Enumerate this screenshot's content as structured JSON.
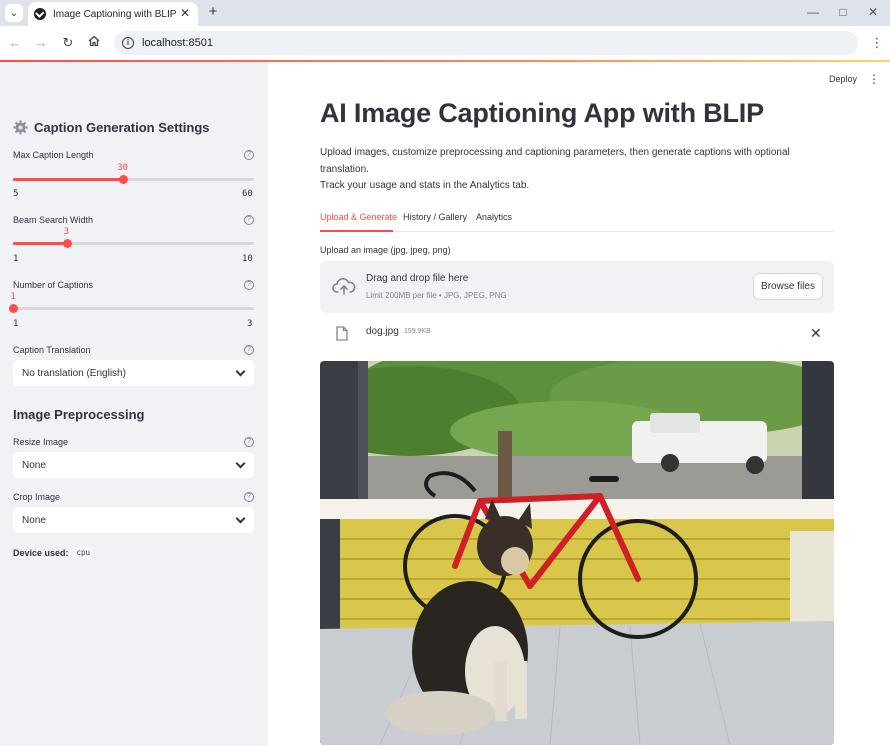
{
  "browser": {
    "tab_title": "Image Captioning with BLIP + A",
    "url": "localhost:8501",
    "icons": [
      "tab-search-icon",
      "favicon-icon",
      "close-icon",
      "plus-icon",
      "minimize-icon",
      "maximize-icon",
      "close-window-icon",
      "back-arrow-icon",
      "forward-arrow-icon",
      "reload-icon",
      "home-icon",
      "site-info-icon",
      "menu-kebab-icon"
    ]
  },
  "sidebar": {
    "title": "Caption Generation Settings",
    "sliders": [
      {
        "label": "Max Caption Length",
        "value": "30",
        "min": "5",
        "max": "60",
        "fraction": 0.455
      },
      {
        "label": "Beam Search Width",
        "value": "3",
        "min": "1",
        "max": "10",
        "fraction": 0.222
      },
      {
        "label": "Number of Captions",
        "value": "1",
        "min": "1",
        "max": "3",
        "fraction": 0.0
      }
    ],
    "translation": {
      "label": "Caption Translation",
      "value": "No translation (English)"
    },
    "preprocessing_heading": "Image Preprocessing",
    "resize": {
      "label": "Resize Image",
      "value": "None"
    },
    "crop": {
      "label": "Crop Image",
      "value": "None"
    },
    "device_label": "Device used:",
    "device_value": "cpu"
  },
  "header": {
    "deploy_label": "Deploy",
    "menu_glyph": "⋮"
  },
  "main": {
    "title": "AI Image Captioning App with BLIP",
    "description_line1": "Upload images, customize preprocessing and captioning parameters, then generate captions with optional translation.",
    "description_line2": "Track your usage and stats in the Analytics tab.",
    "tabs": [
      "Upload & Generate",
      "History / Gallery",
      "Analytics"
    ],
    "active_tab": 0,
    "uploader": {
      "label": "Upload an image (jpg, jpeg, png)",
      "drop_text": "Drag and drop file here",
      "limit_text": "Limit 200MB per file • JPG, JPEG, PNG",
      "browse_label": "Browse files"
    },
    "file": {
      "name": "dog.jpg",
      "size": "159.9KB"
    }
  },
  "colors": {
    "accent": "#ff4b4b",
    "sidebar_bg": "#f0f2f6",
    "text": "#31333f"
  }
}
